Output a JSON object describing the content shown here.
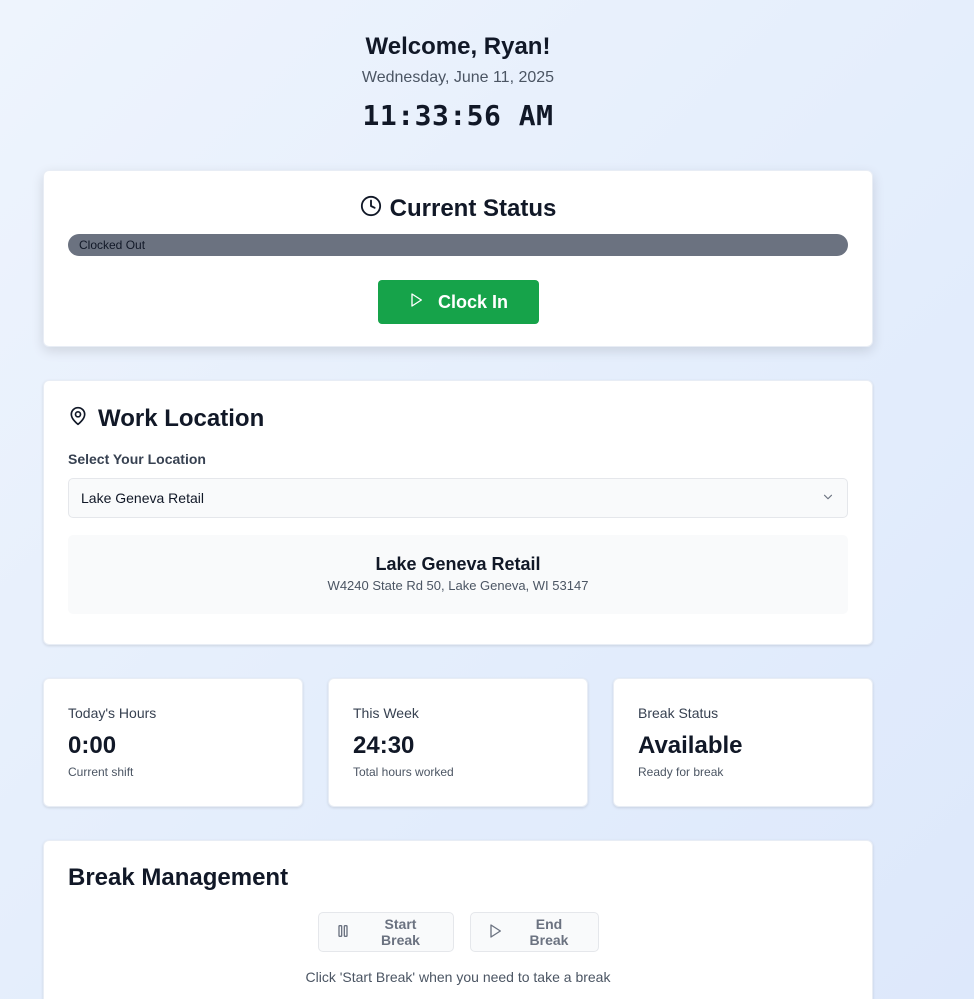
{
  "header": {
    "welcome": "Welcome, Ryan!",
    "date": "Wednesday, June 11, 2025",
    "time": "11:33:56 AM"
  },
  "status": {
    "title": "Current Status",
    "icon": "clock-icon",
    "badge": "Clocked Out",
    "badge_color": "#6b7280",
    "clock_in_label": "Clock In",
    "clock_in_color": "#16a34a"
  },
  "location": {
    "title": "Work Location",
    "icon": "map-pin-icon",
    "select_label": "Select Your Location",
    "selected": "Lake Geneva Retail",
    "info_name": "Lake Geneva Retail",
    "info_address": "W4240 State Rd 50, Lake Geneva, WI 53147"
  },
  "stats": [
    {
      "label": "Today's Hours",
      "value": "0:00",
      "sub": "Current shift"
    },
    {
      "label": "This Week",
      "value": "24:30",
      "sub": "Total hours worked"
    },
    {
      "label": "Break Status",
      "value": "Available",
      "sub": "Ready for break"
    }
  ],
  "break": {
    "title": "Break Management",
    "start_label": "Start Break",
    "end_label": "End Break",
    "hint": "Click 'Start Break' when you need to take a break"
  }
}
